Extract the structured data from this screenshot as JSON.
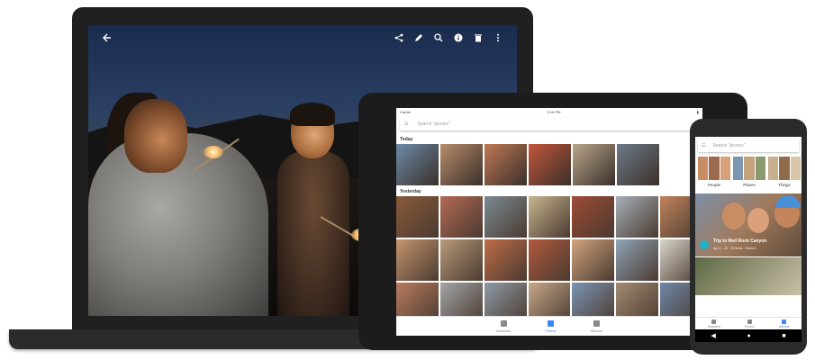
{
  "laptop": {
    "toolbar_icons": [
      "back-arrow-icon",
      "share-icon",
      "edit-pencil-icon",
      "zoom-icon",
      "info-icon",
      "delete-icon",
      "more-vert-icon"
    ]
  },
  "tablet": {
    "status": {
      "carrier": "Carrier",
      "time": "9:16 PM"
    },
    "search_placeholder": "Search \"picnics\"",
    "section_today": "Today",
    "section_yesterday": "Yesterday",
    "nav": [
      {
        "label": "Assistant",
        "active": false
      },
      {
        "label": "Photos",
        "active": true
      },
      {
        "label": "Albums",
        "active": false
      }
    ],
    "today_colors": [
      "#6d8aa8",
      "#b78b6c",
      "#c07857",
      "#c2563b",
      "#b8a48a",
      "#6f7a8a"
    ],
    "yesterday_colors": [
      [
        "#8a5a3a",
        "#b46a55",
        "#7b8a92",
        "#c7b58f",
        "#9e4b35",
        "#a7b0b8",
        "#c2835c"
      ],
      [
        "#c6956e",
        "#b89a7a",
        "#c06c48",
        "#b25a3e",
        "#d1a47e",
        "#8fa4b6",
        "#d9d6cc"
      ],
      [
        "#b97c5f",
        "#a3a6a8",
        "#8f9aa6",
        "#c7a88a",
        "#7c95b3",
        "#a58c73",
        "#6f88a8"
      ]
    ]
  },
  "phone": {
    "search_placeholder": "Search \"picnics\"",
    "categories": [
      {
        "label": "People",
        "colors": [
          "#c98d66",
          "#9c6b4e",
          "#d7a07b"
        ]
      },
      {
        "label": "Places",
        "colors": [
          "#7d96b2",
          "#c4a27b",
          "#8a9a6e"
        ]
      },
      {
        "label": "Things",
        "colors": [
          "#c6b08f",
          "#8f6d4c",
          "#d9c6a8"
        ]
      }
    ],
    "card_title": "Trip to Red Rock Canyon",
    "card_subtitle": "Apr 9 – 10 · 26 items · Shared",
    "nav": [
      {
        "label": "Assistant",
        "active": false
      },
      {
        "label": "Photos",
        "active": false
      },
      {
        "label": "Albums",
        "active": true
      }
    ]
  }
}
